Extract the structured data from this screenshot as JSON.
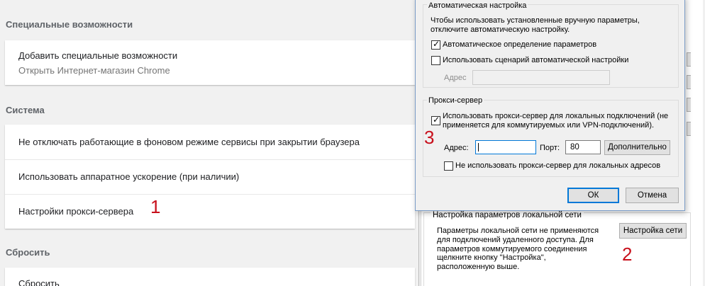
{
  "chrome": {
    "accessibility": {
      "title": "Специальные возможности",
      "add_label": "Добавить специальные возможности",
      "add_sublabel": "Открыть Интернет-магазин Chrome"
    },
    "system": {
      "title": "Система",
      "rows": [
        "Не отключать работающие в фоновом режиме сервисы при закрытии браузера",
        "Использовать аппаратное ускорение (при наличии)",
        "Настройки прокси-сервера"
      ]
    },
    "reset": {
      "title": "Сбросить",
      "row": "Сбросить"
    }
  },
  "annotations": {
    "one": "1",
    "two": "2",
    "three": "3"
  },
  "dialog": {
    "auto_group": {
      "legend": "Автоматическая настройка",
      "description": [
        "Чтобы использовать установленные вручную параметры,",
        "отключите автоматическую настройку."
      ],
      "auto_detect_label": "Автоматическое определение параметров",
      "auto_detect_checked": true,
      "script_label": "Использовать сценарий автоматической настройки",
      "script_checked": false,
      "address_label": "Адрес",
      "address_value": ""
    },
    "proxy_group": {
      "legend": "Прокси-сервер",
      "use_proxy_label": [
        "Использовать прокси-сервер для локальных подключений (не",
        "применяется для коммутируемых или VPN-подключений)."
      ],
      "use_proxy_checked": true,
      "address_label": "Адрес:",
      "address_value": "",
      "port_label": "Порт:",
      "port_value": "80",
      "advanced_button": "Дополнительно",
      "bypass_label": "Не использовать прокси-сервер для локальных адресов",
      "bypass_checked": false
    },
    "ok_button": "ОК",
    "cancel_button": "Отмена"
  },
  "lan": {
    "legend": "Настройка параметров локальной сети",
    "description": [
      "Параметры локальной сети не применяются",
      "для подключений удаленного доступа. Для",
      "параметров коммутируемого соединения",
      "щелкните кнопку \"Настройка\",",
      "расположенную выше."
    ],
    "button": "Настройка сети"
  }
}
